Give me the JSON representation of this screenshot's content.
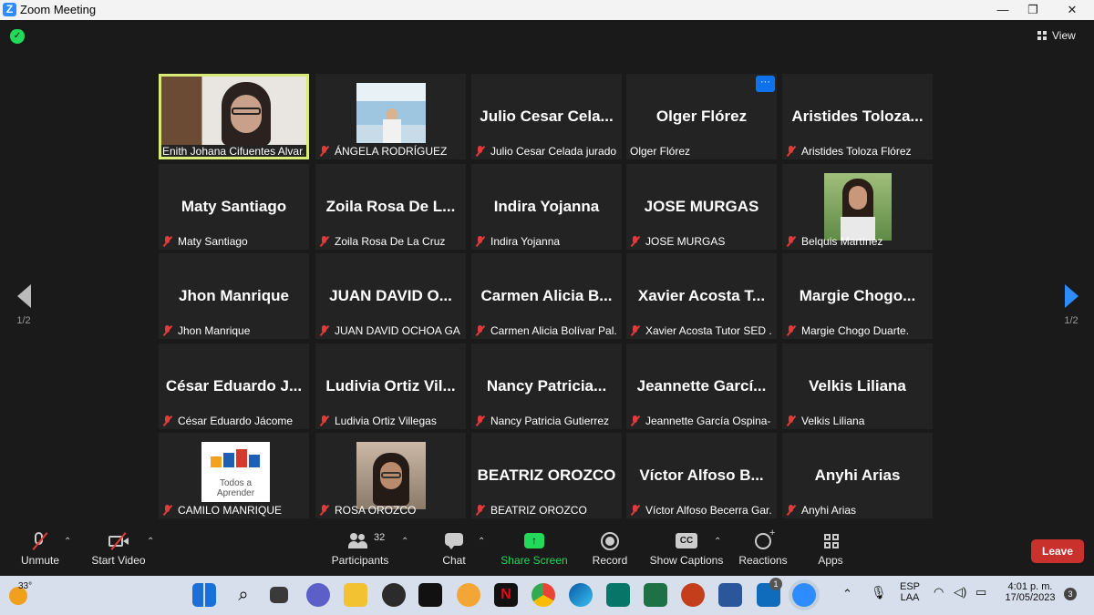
{
  "window": {
    "title": "Zoom Meeting",
    "minimize": "—",
    "restore": "❐",
    "close": "✕"
  },
  "view_label": "View",
  "pagination": {
    "left": "1/2",
    "right": "1/2"
  },
  "tiles": [
    {
      "big": "",
      "cap": "Enith Johana Cifuentes Alvar..."
    },
    {
      "big": "",
      "cap": "ÁNGELA RODRÍGUEZ"
    },
    {
      "big": "Julio  Cesar  Cela...",
      "cap": "Julio Cesar Celada jurado"
    },
    {
      "big": "Olger Flórez",
      "cap": "Olger Flórez",
      "more": "···"
    },
    {
      "big": "Aristides  Toloza...",
      "cap": "Aristides Toloza Flórez"
    },
    {
      "big": "Maty Santiago",
      "cap": "Maty Santiago"
    },
    {
      "big": "Zoila  Rosa  De  L...",
      "cap": "Zoila Rosa De La Cruz"
    },
    {
      "big": "Indira Yojanna",
      "cap": "Indira Yojanna"
    },
    {
      "big": "JOSE MURGAS",
      "cap": "JOSE MURGAS"
    },
    {
      "big": "",
      "cap": "Belquis Martínez"
    },
    {
      "big": "Jhon Manrique",
      "cap": "Jhon Manrique"
    },
    {
      "big": "JUAN  DAVID  O...",
      "cap": "JUAN DAVID OCHOA GA..."
    },
    {
      "big": "Carmen  Alicia  B...",
      "cap": "Carmen Alicia Bolívar Pal..."
    },
    {
      "big": "Xavier  Acosta  T...",
      "cap": "Xavier Acosta Tutor SED ..."
    },
    {
      "big": "Margie  Chogo...",
      "cap": "Margie Chogo Duarte."
    },
    {
      "big": "César  Eduardo  J...",
      "cap": "César Eduardo Jácome"
    },
    {
      "big": "Ludivia  Ortiz  Vil...",
      "cap": "Ludivia Ortiz Villegas"
    },
    {
      "big": "Nancy  Patricia...",
      "cap": "Nancy Patricia Gutierrez"
    },
    {
      "big": "Jeannette  Garcí...",
      "cap": "Jeannette García Ospina-..."
    },
    {
      "big": "Velkis Liliana",
      "cap": "Velkis Liliana"
    },
    {
      "big": "",
      "cap": "CAMILO MANRIQUE",
      "logo_text": "Todos a Aprender"
    },
    {
      "big": "",
      "cap": "ROSA OROZCO"
    },
    {
      "big": "BEATRIZ OROZCO",
      "cap": "BEATRIZ OROZCO"
    },
    {
      "big": "Víctor  Alfoso  B...",
      "cap": "Víctor Alfoso Becerra Gar..."
    },
    {
      "big": "Anyhi Arias",
      "cap": "Anyhi Arias"
    }
  ],
  "toolbar": {
    "unmute": "Unmute",
    "stop_video": "Start Video",
    "participants": "Participants",
    "participants_count": "32",
    "chat": "Chat",
    "share": "Share Screen",
    "record": "Record",
    "captions": "Show Captions",
    "captions_icon": "CC",
    "reactions": "Reactions",
    "apps": "Apps",
    "leave": "Leave"
  },
  "taskbar": {
    "weather": "33°",
    "lang_top": "ESP",
    "lang_bottom": "LAA",
    "time": "4:01 p. m.",
    "date": "17/05/2023",
    "notifications": "3",
    "badge": "1"
  },
  "colors": {
    "accent": "#2d8cff",
    "active_speaker": "#d6ec76",
    "leave": "#c8312c",
    "share": "#23d959"
  }
}
